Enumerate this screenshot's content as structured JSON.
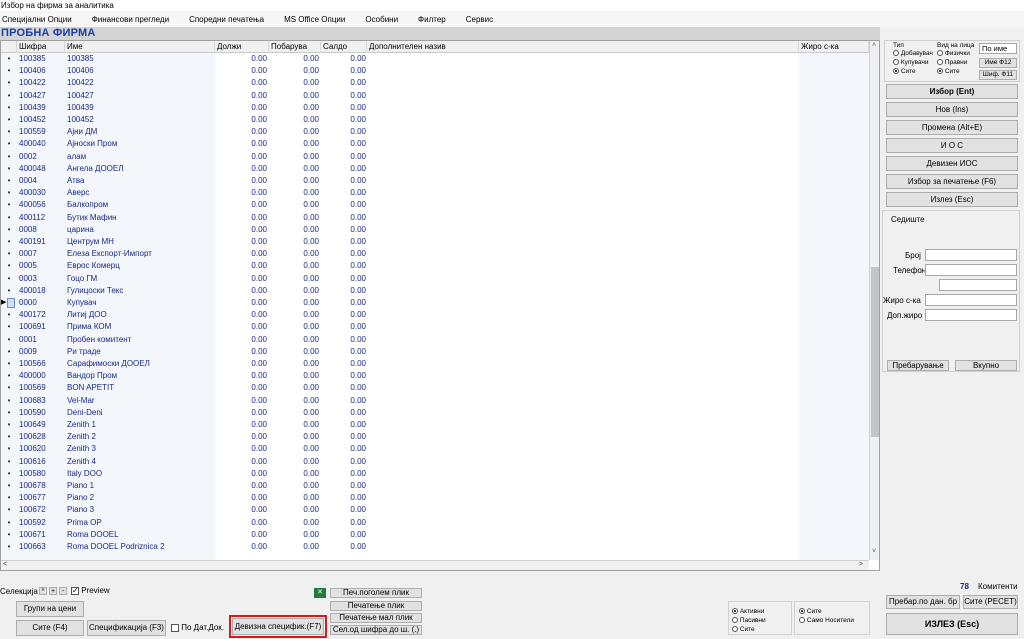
{
  "window": {
    "title": "Избор на фирма за аналитика"
  },
  "menu": [
    "Специјални Опции",
    "Финансови прегледи",
    "Споредни печатења",
    "MS Office Опции",
    "Особини",
    "Филтер",
    "Сервис"
  ],
  "banner": "ПРОБНА ФИРМА",
  "grid": {
    "headers": {
      "code": "Шифра",
      "name": "Име",
      "debit": "Должи",
      "credit": "Побарува",
      "balance": "Салдо",
      "additional": "Дополнителен назив",
      "account": "Жиро с-ка"
    },
    "current_row": 20,
    "rows": [
      [
        "100385",
        "100385"
      ],
      [
        "100406",
        "100406"
      ],
      [
        "100422",
        "100422"
      ],
      [
        "100427",
        "100427"
      ],
      [
        "100439",
        "100439"
      ],
      [
        "100452",
        "100452"
      ],
      [
        "100559",
        "Ајни ДМ"
      ],
      [
        "400040",
        "Ајноски Пром"
      ],
      [
        "0002",
        "алам"
      ],
      [
        "400048",
        "Ангела ДООЕЛ"
      ],
      [
        "0004",
        "Атва"
      ],
      [
        "400030",
        "Аверс"
      ],
      [
        "400056",
        "Балкопром"
      ],
      [
        "400112",
        "Бутик Мафин"
      ],
      [
        "0008",
        "царина"
      ],
      [
        "400191",
        "Центрум МН"
      ],
      [
        "0007",
        "Елеза Експорт-Импорт"
      ],
      [
        "0005",
        "Еврос Комерц"
      ],
      [
        "0003",
        "Гоцо ГМ"
      ],
      [
        "400018",
        "Гулицоски Текс"
      ],
      [
        "0000",
        "Купувач"
      ],
      [
        "400172",
        "Литиј ДОО"
      ],
      [
        "100691",
        "Прима КОМ"
      ],
      [
        "0001",
        "Пробен комитент"
      ],
      [
        "0009",
        "Ри траде"
      ],
      [
        "100566",
        "Сарафимоски ДООЕЛ"
      ],
      [
        "400000",
        "Вандор Пром"
      ],
      [
        "100569",
        "BON APETIT"
      ],
      [
        "100683",
        "Vel-Mar"
      ],
      [
        "100590",
        "Deni-Deni"
      ],
      [
        "100649",
        "Zenith 1"
      ],
      [
        "100628",
        "Zenith 2"
      ],
      [
        "100620",
        "Zenith 3"
      ],
      [
        "100616",
        "Zenith 4"
      ],
      [
        "100580",
        "Italy DOO"
      ],
      [
        "100678",
        "Piano 1"
      ],
      [
        "100677",
        "Piano 2"
      ],
      [
        "100672",
        "Piano 3"
      ],
      [
        "100592",
        "Prima OP"
      ],
      [
        "100671",
        "Roma DOOEL"
      ],
      [
        "100663",
        "Roma DOOEL Podriznica 2"
      ]
    ],
    "zero": "0.00"
  },
  "filters": {
    "type_label": "Тип",
    "type_options": [
      {
        "label": "Добавувач",
        "on": false
      },
      {
        "label": "Купувачи",
        "on": false
      },
      {
        "label": "Сите",
        "on": true
      }
    ],
    "person_label": "Вид на лица",
    "person_options": [
      {
        "label": "Физички",
        "on": false
      },
      {
        "label": "Правни",
        "on": false
      },
      {
        "label": "Сите",
        "on": true
      }
    ],
    "sort_value": "По име",
    "name_btn": "Име Ф12",
    "code_btn": "Шиф. Ф11"
  },
  "actions": [
    "Избор (Ent)",
    "Нов (Ins)",
    "Промена (Alt+E)",
    "И О С",
    "Девизен ИОС",
    "Избор за печатење (F6)",
    "Излез (Esc)"
  ],
  "details": {
    "seat": "Седиште",
    "number": "Број",
    "phone": "Телефон",
    "account": "Жиро с-ка",
    "extra_account": "Доп.жиро",
    "search_btn": "Пребарување",
    "total_btn": "Вкупно"
  },
  "bottom": {
    "selection": "Селекција",
    "preview": "Preview",
    "price_groups": "Групи на цени",
    "all_f4": "Сите (F4)",
    "spec_f3": "Спецификација (F3)",
    "by_date": "По Дат.Док.",
    "fx_spec": "Девизна специфик.(F7)",
    "print_large": "Печ.поголем плик",
    "print_env": "Печатење плик",
    "print_small": "Печатење мал плик",
    "code_range": "Сел.од шифра до ш. (.)",
    "status_options": [
      {
        "label": "Активни",
        "on": true
      },
      {
        "label": "Пасивни",
        "on": false
      },
      {
        "label": "Сите",
        "on": false
      }
    ],
    "carrier_options": [
      {
        "label": "Сите",
        "on": true
      },
      {
        "label": "Само Носители",
        "on": false
      }
    ],
    "count": "78",
    "count_label": "Комитенти",
    "search_by_tax": "Пребар.по дан. бр",
    "all_reset": "Сите (РЕСЕТ)",
    "exit": "ИЗЛЕЗ   (Esc)"
  }
}
